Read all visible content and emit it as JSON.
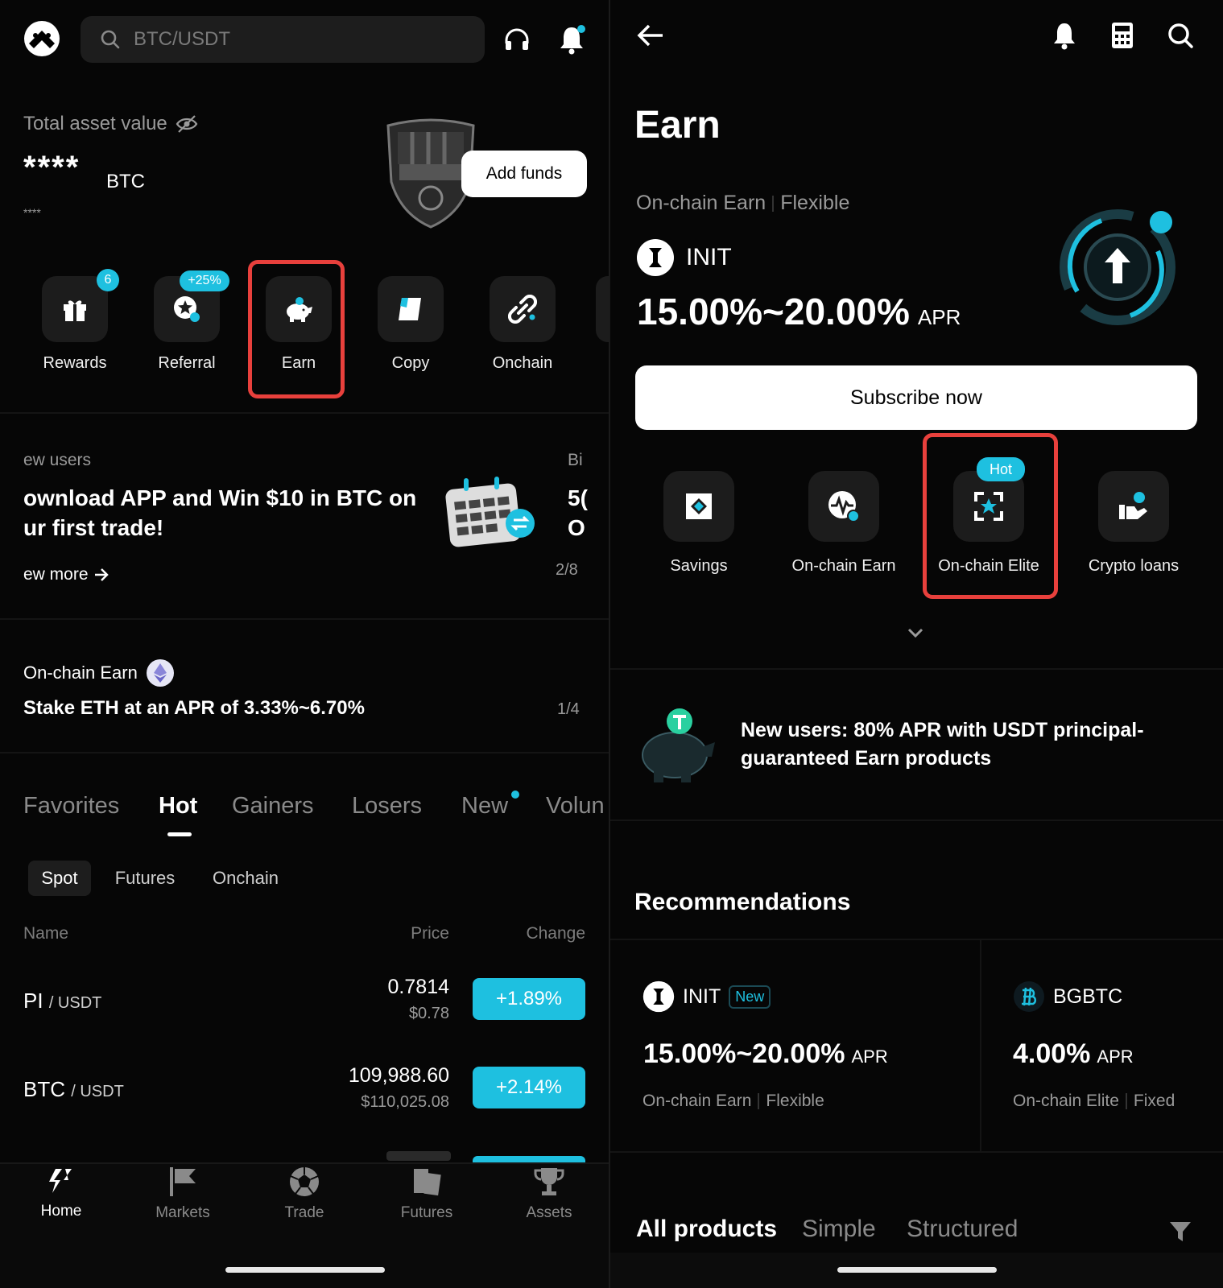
{
  "left": {
    "search": {
      "placeholder": "BTC/USDT"
    },
    "asset": {
      "label": "Total asset value",
      "masked_value": "****",
      "unit": "BTC",
      "masked_sub": "****",
      "add_funds": "Add funds"
    },
    "quick_actions": [
      {
        "label": "Rewards",
        "badge": "6"
      },
      {
        "label": "Referral",
        "badge": "+25%"
      },
      {
        "label": "Earn"
      },
      {
        "label": "Copy"
      },
      {
        "label": "Onchain"
      }
    ],
    "promo": {
      "tag": "ew users",
      "title_line1": "ownload APP and Win $10 in BTC on",
      "title_line2": "ur first trade!",
      "link": "ew more",
      "side_tag": "Bi",
      "side_line1": "5(",
      "side_line2": "O",
      "pager": "2/8"
    },
    "onchain_banner": {
      "title": "On-chain Earn",
      "text": "Stake ETH at an APR of 3.33%~6.70%",
      "pager": "1/4"
    },
    "market_tabs": [
      "Favorites",
      "Hot",
      "Gainers",
      "Losers",
      "New",
      "Volun"
    ],
    "active_tab": "Hot",
    "sub_tabs": [
      "Spot",
      "Futures",
      "Onchain"
    ],
    "columns": {
      "name": "Name",
      "price": "Price",
      "change": "Change"
    },
    "rows": [
      {
        "base": "PI",
        "quote": "/ USDT",
        "price": "0.7814",
        "fiat": "$0.78",
        "change": "+1.89%"
      },
      {
        "base": "BTC",
        "quote": "/ USDT",
        "price": "109,988.60",
        "fiat": "$110,025.08",
        "change": "+2.14%"
      }
    ],
    "bottom_nav": [
      "Home",
      "Markets",
      "Trade",
      "Futures",
      "Assets"
    ]
  },
  "right": {
    "title": "Earn",
    "hero": {
      "category": "On-chain Earn",
      "term": "Flexible",
      "coin": "INIT",
      "apr_value": "15.00%~20.00%",
      "apr_label": "APR",
      "subscribe": "Subscribe now"
    },
    "products": [
      {
        "label": "Savings"
      },
      {
        "label": "On-chain Earn"
      },
      {
        "label": "On-chain Elite",
        "badge": "Hot"
      },
      {
        "label": "Crypto loans"
      }
    ],
    "new_user_banner": {
      "line1": "New users: 80% APR with USDT principal-",
      "line2": "guaranteed Earn products"
    },
    "recommendations": {
      "title": "Recommendations",
      "cards": [
        {
          "coin": "INIT",
          "badge": "New",
          "apr": "15.00%~20.00%",
          "apr_label": "APR",
          "category": "On-chain Earn",
          "term": "Flexible"
        },
        {
          "coin": "BGBTC",
          "apr": "4.00%",
          "apr_label": "APR",
          "category": "On-chain Elite",
          "term": "Fixed"
        }
      ]
    },
    "product_tabs": [
      "All products",
      "Simple",
      "Structured"
    ]
  },
  "colors": {
    "accent": "#1ec0e0",
    "highlight": "#e8403c",
    "background": "#060606"
  }
}
